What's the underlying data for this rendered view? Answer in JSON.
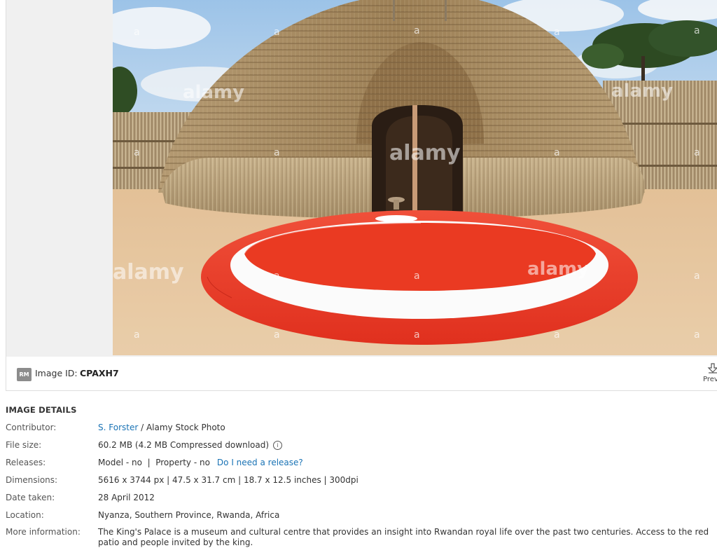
{
  "image_id_bar": {
    "badge": "RM",
    "label": "Image ID:",
    "value": "CPAXH7",
    "preview_label": "Prev"
  },
  "details": {
    "title": "IMAGE DETAILS",
    "contributor_label": "Contributor:",
    "contributor_name": "S. Forster",
    "contributor_suffix": " / Alamy Stock Photo",
    "file_size_label": "File size:",
    "file_size_value": "60.2 MB (4.2 MB Compressed download)",
    "releases_label": "Releases:",
    "releases_value": "Model - no  |  Property - no",
    "releases_link": "Do I need a release?",
    "dimensions_label": "Dimensions:",
    "dimensions_value": "5616 x 3744 px | 47.5 x 31.7 cm | 18.7 x 12.5 inches | 300dpi",
    "date_label": "Date taken:",
    "date_value": "28 April 2012",
    "location_label": "Location:",
    "location_value": "Nyanza, Southern Province, Rwanda, Africa",
    "more_label": "More information:",
    "more_value": "The King's Palace is a museum and cultural centre that provides an insight into Rwandan royal life over the past two centuries. Access to the red patio and people invited by the king."
  },
  "watermark": "alamy",
  "colors": {
    "link": "#1a73b5",
    "patio_red": "#e0301e",
    "thatch": "#b79a6c",
    "sand": "#e8c9a4"
  }
}
